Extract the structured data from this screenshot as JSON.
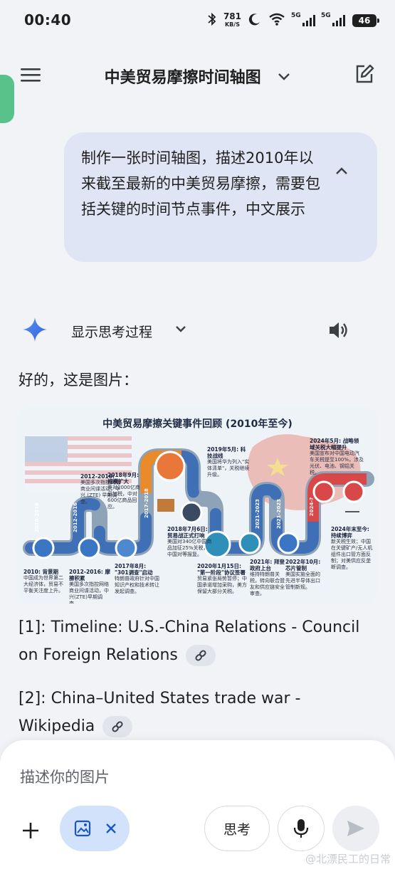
{
  "status_bar": {
    "time": "00:40",
    "net_speed": "781",
    "net_unit": "KB/S",
    "sim1_label": "5G",
    "sim2_label": "5G",
    "battery": "46"
  },
  "header": {
    "title": "中美贸易摩擦时间轴图",
    "icons": [
      "menu-icon",
      "chevron-down-icon",
      "edit-icon"
    ]
  },
  "user_message": {
    "text": "制作一张时间轴图，描述2010年以来截至最新的中美贸易摩擦，需要包括关键的时间节点事件，中文展示"
  },
  "response": {
    "show_thinking_label": "显示思考过程",
    "intro": "好的，这是图片：",
    "image": {
      "title": "中美贸易摩擦关键事件回顾 (2010年至今)",
      "year_segments": [
        "2010-2016",
        "2012-2016",
        "2017-2018",
        "2021-2023",
        "2021-2023",
        "2024-?"
      ],
      "events": [
        {
          "heading": "2010: 背景期",
          "body": "中国成为世界第二大经济体，贸易不平衡关注度上升。"
        },
        {
          "heading": "2012-2016: 摩擦积累",
          "body": "美国多次指控网络商业间谍活动，中兴(ZTE)早期调查。"
        },
        {
          "heading": "2012-2016:",
          "body": "美国多次指控网络商业间谍活动；中兴 (ZTE) 早期调查。"
        },
        {
          "heading": "2017年8月: \"301调查\"启动",
          "body": "特朗普政府针对中国知识产权和技术转让发起调查。"
        },
        {
          "heading": "2018年9月: 规模扩大",
          "body": "美对2000亿商品加税，中对600亿商品回应。"
        },
        {
          "heading": "2018年7月6日: 贸易战正式打响",
          "body": "美国对340亿中国商品加征25%关税，中国对等报复。"
        },
        {
          "heading": "2019年5月: 科技战线",
          "body": "美国将华为列入\"实体清单\"，关税继续升级。"
        },
        {
          "heading": "2020年1月15日: \"第一阶段\"协议签署",
          "body": "贸易紧张局势暂停；中国承诺增加采购，美方保留大部分关税。"
        },
        {
          "heading": "2021年: 拜登政府上台",
          "body": "维持特朗普关税，转向联合盟友和供应链安全审查。"
        },
        {
          "heading": "2022年10月: 芯片管制",
          "body": "美国实施全面的先进半导体出口管制新规。"
        },
        {
          "heading": "2024年5月: 战略领域关税大幅提升",
          "body": "美国宣布对中国电动汽车关税提至100%，涉及光伏、电池、钢铝关税。"
        },
        {
          "heading": "2024年末至今: 持续博弈",
          "body": "新关税生效；中国在关键矿产/无人机组件出口管方面反制；对美供应反垄断调查。"
        }
      ]
    },
    "references": [
      {
        "label": "[1]: Timeline: U.S.-China Relations - Council on Foreign Relations"
      },
      {
        "label": "[2]: China–United States trade war - Wikipedia"
      }
    ]
  },
  "composer": {
    "placeholder": "描述你的图片",
    "think_label": "思考"
  },
  "watermark": "@北漂民工的日常",
  "colors": {
    "user_bubble": "#dfe5f4",
    "image_chip": "#d3e2fb",
    "sparkle": "#3d7cf0",
    "left_tab": "#59c28a"
  }
}
